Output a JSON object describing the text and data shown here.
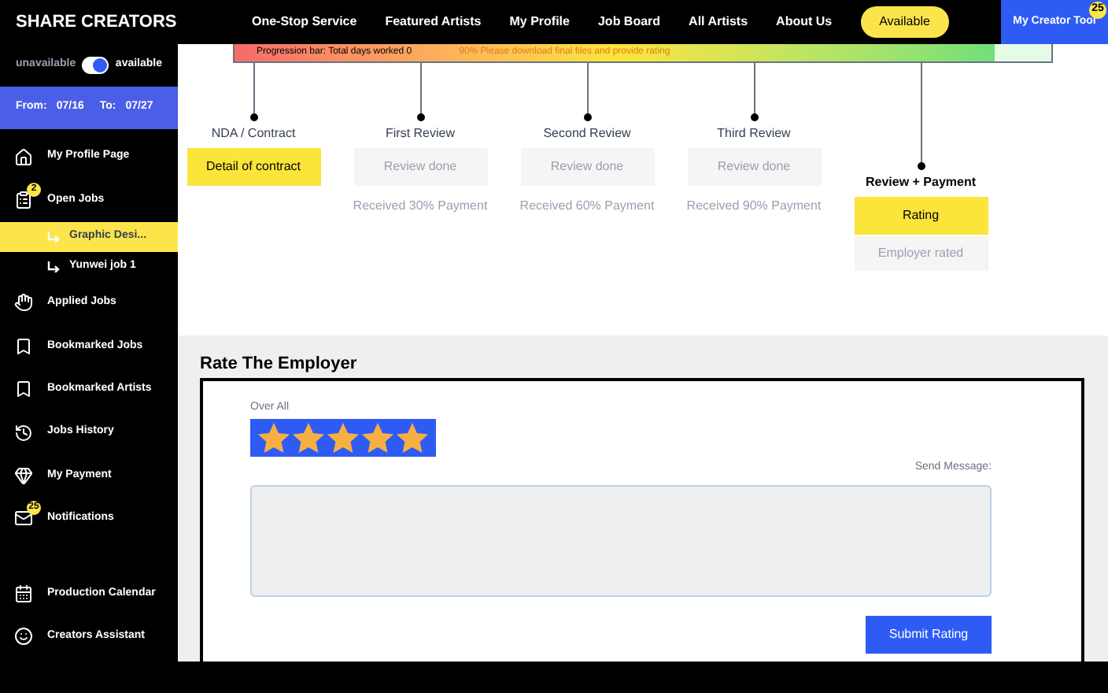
{
  "logo": "SHARE CREATORS",
  "nav": [
    "One-Stop Service",
    "Featured Artists",
    "My Profile",
    "Job Board",
    "All Artists",
    "About Us"
  ],
  "status_pill": "Available",
  "creator_tool": {
    "label": "My Creator Tool",
    "badge": "25"
  },
  "availability": {
    "off_label": "unavailable",
    "on_label": "available",
    "on": true
  },
  "dates": {
    "from_label": "From:",
    "from": "07/16",
    "to_label": "To:",
    "to": "07/27"
  },
  "sidebar": {
    "items": [
      {
        "kind": "main",
        "label": "My Profile Page",
        "selected": false
      },
      {
        "kind": "main",
        "label": "Open Jobs",
        "badge": "2",
        "selected": false
      },
      {
        "kind": "sub",
        "label": "Graphic Desi...",
        "selected": true
      },
      {
        "kind": "sub",
        "label": "Yunwei job 1",
        "selected": false
      },
      {
        "kind": "main",
        "label": "Applied Jobs",
        "selected": false
      },
      {
        "kind": "main",
        "label": "Bookmarked Jobs",
        "selected": false
      },
      {
        "kind": "main",
        "label": "Bookmarked Artists",
        "selected": false
      },
      {
        "kind": "main",
        "label": "Jobs History",
        "selected": false
      },
      {
        "kind": "main",
        "label": "My Payment",
        "selected": false
      },
      {
        "kind": "main",
        "label": "Notifications",
        "badge": "25",
        "selected": false
      },
      {
        "kind": "spacer"
      },
      {
        "kind": "main",
        "label": "Production Calendar",
        "selected": false
      },
      {
        "kind": "main",
        "label": "Creators Assistant",
        "selected": false
      }
    ]
  },
  "progress": {
    "label": "Progression bar: Total days worked 0",
    "note": "90% Please download final files and provide rating",
    "level": 0.93
  },
  "steps": [
    {
      "kind": "step",
      "label": "NDA / Contract",
      "button": "Detail of contract",
      "active": true
    },
    {
      "kind": "step",
      "label": "First Review",
      "button": "Review done",
      "active": false,
      "note": "Received 30% Payment"
    },
    {
      "kind": "step",
      "label": "Second Review",
      "button": "Review done",
      "active": false,
      "note": "Received 60% Payment"
    },
    {
      "kind": "step",
      "label": "Third Review",
      "button": "Review done",
      "active": false,
      "note": "Received 90% Payment"
    },
    {
      "kind": "final",
      "label": "Review + Payment",
      "button": "Rating",
      "active": true,
      "note": "Employer rated"
    }
  ],
  "rating": {
    "title": "Rate The Employer",
    "overall_label": "Over All",
    "stars": 5,
    "message_label": "Send Message:",
    "submit": "Submit Rating"
  }
}
